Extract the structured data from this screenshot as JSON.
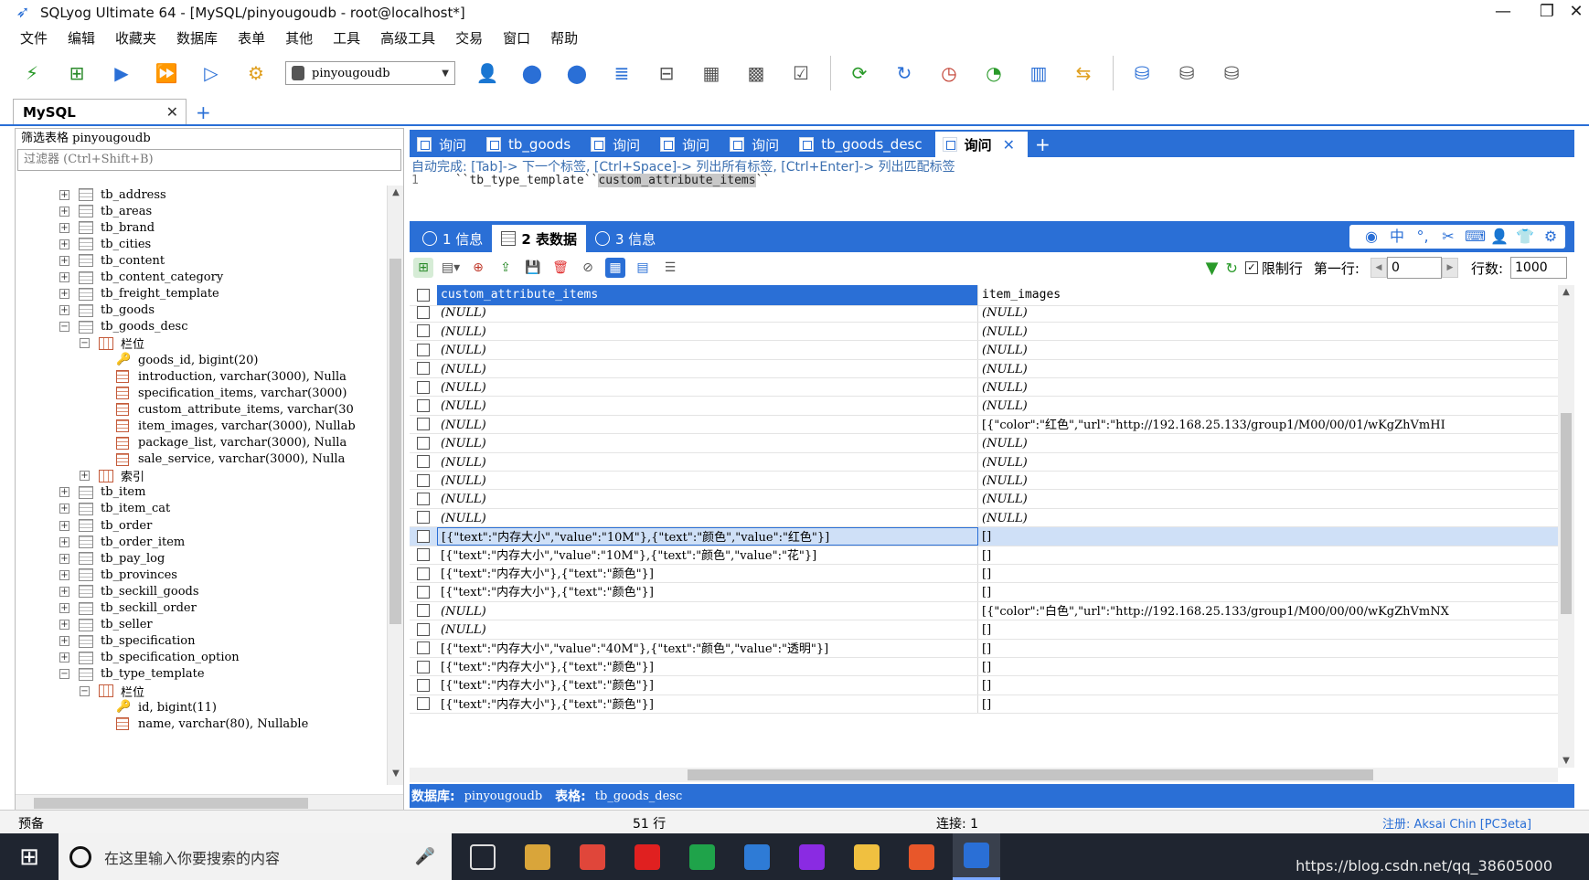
{
  "window": {
    "title": "SQLyog Ultimate 64 - [MySQL/pinyougoudb - root@localhost*]",
    "controls": [
      "—",
      "❐",
      "✕"
    ]
  },
  "menu": [
    "文件",
    "编辑",
    "收藏夹",
    "数据库",
    "表单",
    "其他",
    "工具",
    "高级工具",
    "交易",
    "窗口",
    "帮助"
  ],
  "toolbar": {
    "database_select": "pinyougoudb",
    "icons": [
      "connect-icon",
      "new-query-icon",
      "execute-icon",
      "execute-all-icon",
      "execute-edit-icon",
      "schema-sync-icon",
      "user-manager-icon",
      "create-db-icon",
      "copy-db-icon",
      "backup-icon",
      "import-icon",
      "table-data-icon",
      "schema-designer-icon",
      "query-builder-icon",
      "refresh-icon",
      "reload-icon",
      "scheduler-icon",
      "job-icon",
      "table-diagnostics-icon",
      "compare-icon",
      "database-icon",
      "export-icon",
      "import-export-icon"
    ]
  },
  "connection_tab": {
    "label": "MySQL",
    "close": "✕",
    "add": "+"
  },
  "left_panel": {
    "filter_title": "筛选表格 pinyougoudb",
    "filter_placeholder": "过滤器 (Ctrl+Shift+B)",
    "tree": [
      {
        "kind": "table",
        "label": "tb_address",
        "exp": "+"
      },
      {
        "kind": "table",
        "label": "tb_areas",
        "exp": "+"
      },
      {
        "kind": "table",
        "label": "tb_brand",
        "exp": "+"
      },
      {
        "kind": "table",
        "label": "tb_cities",
        "exp": "+"
      },
      {
        "kind": "table",
        "label": "tb_content",
        "exp": "+"
      },
      {
        "kind": "table",
        "label": "tb_content_category",
        "exp": "+"
      },
      {
        "kind": "table",
        "label": "tb_freight_template",
        "exp": "+"
      },
      {
        "kind": "table",
        "label": "tb_goods",
        "exp": "+"
      },
      {
        "kind": "table",
        "label": "tb_goods_desc",
        "exp": "−"
      },
      {
        "kind": "group",
        "label": "栏位",
        "exp": "−"
      },
      {
        "kind": "key",
        "label": "goods_id, bigint(20)"
      },
      {
        "kind": "field",
        "label": "introduction, varchar(3000), Nulla"
      },
      {
        "kind": "field",
        "label": "specification_items, varchar(3000)"
      },
      {
        "kind": "field",
        "label": "custom_attribute_items, varchar(30"
      },
      {
        "kind": "field",
        "label": "item_images, varchar(3000), Nullab"
      },
      {
        "kind": "field",
        "label": "package_list, varchar(3000), Nulla"
      },
      {
        "kind": "field",
        "label": "sale_service, varchar(3000), Nulla"
      },
      {
        "kind": "group",
        "label": "索引",
        "exp": "+"
      },
      {
        "kind": "table",
        "label": "tb_item",
        "exp": "+"
      },
      {
        "kind": "table",
        "label": "tb_item_cat",
        "exp": "+"
      },
      {
        "kind": "table",
        "label": "tb_order",
        "exp": "+"
      },
      {
        "kind": "table",
        "label": "tb_order_item",
        "exp": "+"
      },
      {
        "kind": "table",
        "label": "tb_pay_log",
        "exp": "+"
      },
      {
        "kind": "table",
        "label": "tb_provinces",
        "exp": "+"
      },
      {
        "kind": "table",
        "label": "tb_seckill_goods",
        "exp": "+"
      },
      {
        "kind": "table",
        "label": "tb_seckill_order",
        "exp": "+"
      },
      {
        "kind": "table",
        "label": "tb_seller",
        "exp": "+"
      },
      {
        "kind": "table",
        "label": "tb_specification",
        "exp": "+"
      },
      {
        "kind": "table",
        "label": "tb_specification_option",
        "exp": "+"
      },
      {
        "kind": "table",
        "label": "tb_type_template",
        "exp": "−"
      },
      {
        "kind": "group",
        "label": "栏位",
        "exp": "−"
      },
      {
        "kind": "key",
        "label": "id, bigint(11)"
      },
      {
        "kind": "field",
        "label": "name, varchar(80), Nullable"
      }
    ]
  },
  "query_tabs": [
    {
      "label": "询问",
      "active": false
    },
    {
      "label": "tb_goods",
      "active": false
    },
    {
      "label": "询问",
      "active": false
    },
    {
      "label": "询问",
      "active": false
    },
    {
      "label": "询问",
      "active": false
    },
    {
      "label": "tb_goods_desc",
      "active": false
    },
    {
      "label": "询问",
      "active": true
    }
  ],
  "editor": {
    "hint": "自动完成: [Tab]-> 下一个标签, [Ctrl+Space]-> 列出所有标签, [Ctrl+Enter]-> 列出匹配标签",
    "line_number": "1",
    "line_prefix": "``tb_type_template``",
    "line_highlight": "custom_attribute_items",
    "line_suffix": "``"
  },
  "result_tabs": [
    {
      "label": "1 信息",
      "active": false
    },
    {
      "label": "2 表数据",
      "active": true
    },
    {
      "label": "3 信息",
      "active": false
    }
  ],
  "grid_toolbar": {
    "limit_label": "限制行",
    "limit_checked": true,
    "first_row_label": "第一行:",
    "first_row_value": "0",
    "rows_label": "行数:",
    "rows_value": "1000"
  },
  "grid": {
    "columns": [
      "custom_attribute_items",
      "item_images"
    ],
    "selected_row": 12,
    "rows": [
      [
        "(NULL)",
        "(NULL)"
      ],
      [
        "(NULL)",
        "(NULL)"
      ],
      [
        "(NULL)",
        "(NULL)"
      ],
      [
        "(NULL)",
        "(NULL)"
      ],
      [
        "(NULL)",
        "(NULL)"
      ],
      [
        "(NULL)",
        "(NULL)"
      ],
      [
        "(NULL)",
        "[{\"color\":\"红色\",\"url\":\"http://192.168.25.133/group1/M00/00/01/wKgZhVmHI"
      ],
      [
        "(NULL)",
        "(NULL)"
      ],
      [
        "(NULL)",
        "(NULL)"
      ],
      [
        "(NULL)",
        "(NULL)"
      ],
      [
        "(NULL)",
        "(NULL)"
      ],
      [
        "(NULL)",
        "(NULL)"
      ],
      [
        "[{\"text\":\"内存大小\",\"value\":\"10M\"},{\"text\":\"颜色\",\"value\":\"红色\"}]",
        "[]"
      ],
      [
        "[{\"text\":\"内存大小\",\"value\":\"10M\"},{\"text\":\"颜色\",\"value\":\"花\"}]",
        "[]"
      ],
      [
        "[{\"text\":\"内存大小\"},{\"text\":\"颜色\"}]",
        "[]"
      ],
      [
        "[{\"text\":\"内存大小\"},{\"text\":\"颜色\"}]",
        "[]"
      ],
      [
        "(NULL)",
        "[{\"color\":\"白色\",\"url\":\"http://192.168.25.133/group1/M00/00/00/wKgZhVmNX"
      ],
      [
        "(NULL)",
        "[]"
      ],
      [
        "[{\"text\":\"内存大小\",\"value\":\"40M\"},{\"text\":\"颜色\",\"value\":\"透明\"}]",
        "[]"
      ],
      [
        "[{\"text\":\"内存大小\"},{\"text\":\"颜色\"}]",
        "[]"
      ],
      [
        "[{\"text\":\"内存大小\"},{\"text\":\"颜色\"}]",
        "[]"
      ],
      [
        "[{\"text\":\"内存大小\"},{\"text\":\"颜色\"}]",
        "[]"
      ]
    ]
  },
  "result_status": {
    "db_label": "数据库:",
    "db_value": "pinyougoudb",
    "table_label": "表格:",
    "table_value": "tb_goods_desc"
  },
  "app_status": {
    "left": "预备",
    "rows": "51 行",
    "connection": "连接: 1",
    "register": "注册: Aksai Chin [PC3eta]"
  },
  "taskbar": {
    "search_placeholder": "在这里输入你要搜索的内容",
    "url": "https://blog.csdn.net/qq_38605000",
    "apps": [
      {
        "name": "taskview-icon",
        "color": "#1f2530"
      },
      {
        "name": "files-app-icon",
        "color": "#d9a53a"
      },
      {
        "name": "chrome-icon",
        "color": "#e0463a"
      },
      {
        "name": "red-app-icon",
        "color": "#e02020"
      },
      {
        "name": "green-app-icon",
        "color": "#1fa34a"
      },
      {
        "name": "blue-app-icon",
        "color": "#2e7bd6"
      },
      {
        "name": "idea-app-icon",
        "color": "#8a2be2"
      },
      {
        "name": "explorer-icon",
        "color": "#f0c040"
      },
      {
        "name": "pdf-app-icon",
        "color": "#e8572a"
      },
      {
        "name": "sqlyog-app-icon",
        "color": "#2a6fd6"
      }
    ]
  },
  "colors": {
    "accent": "#2a6fd6",
    "selected_row": "#cfe0f7"
  }
}
